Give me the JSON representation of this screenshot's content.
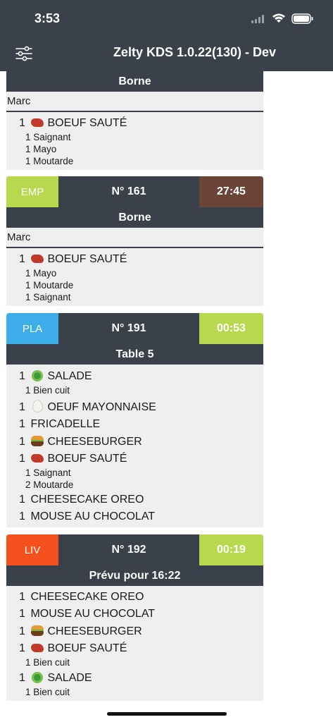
{
  "status": {
    "time": "3:53"
  },
  "nav": {
    "title": "Zelty KDS 1.0.22(130) - Dev"
  },
  "colors": {
    "EMP": "#b8d84e",
    "PLA": "#3daee9",
    "LIV": "#f4511e",
    "timer_late": "#6b4438",
    "timer_ok": "#b8d84e",
    "dark": "#3a414a"
  },
  "orders": [
    {
      "sub": "Borne",
      "customer": "Marc",
      "items": [
        {
          "qty": "1",
          "icon": "steak-icon",
          "name": "BOEUF SAUTÉ",
          "mods": [
            "1 Saignant",
            "1 Mayo",
            "1 Moutarde"
          ]
        }
      ]
    },
    {
      "type": "EMP",
      "number": "N° 161",
      "timer": "27:45",
      "sub": "Borne",
      "customer": "Marc",
      "items": [
        {
          "qty": "1",
          "icon": "steak-icon",
          "name": "BOEUF SAUTÉ",
          "mods": [
            "1 Mayo",
            "1 Moutarde",
            "1 Saignant"
          ]
        }
      ]
    },
    {
      "type": "PLA",
      "number": "N° 191",
      "timer": "00:53",
      "sub": "Table 5",
      "items": [
        {
          "qty": "1",
          "icon": "salad-icon",
          "name": "SALADE",
          "mods": [
            "1 Bien cuit"
          ]
        },
        {
          "qty": "1",
          "icon": "egg-icon",
          "name": "OEUF MAYONNAISE",
          "mods": []
        },
        {
          "qty": "1",
          "name": "FRICADELLE",
          "mods": []
        },
        {
          "qty": "1",
          "icon": "burger-icon",
          "name": "CHEESEBURGER",
          "mods": []
        },
        {
          "qty": "1",
          "icon": "steak-icon",
          "name": "BOEUF SAUTÉ",
          "mods": [
            "1 Saignant",
            "2 Moutarde"
          ]
        },
        {
          "qty": "1",
          "name": "CHEESECAKE OREO",
          "mods": []
        },
        {
          "qty": "1",
          "name": "MOUSE AU CHOCOLAT",
          "mods": []
        }
      ]
    },
    {
      "type": "LIV",
      "number": "N° 192",
      "timer": "00:19",
      "sub": "Prévu pour 16:22",
      "items": [
        {
          "qty": "1",
          "name": "CHEESECAKE OREO",
          "mods": []
        },
        {
          "qty": "1",
          "name": "MOUSE AU CHOCOLAT",
          "mods": []
        },
        {
          "qty": "1",
          "icon": "burger-icon",
          "name": "CHEESEBURGER",
          "mods": []
        },
        {
          "qty": "1",
          "icon": "steak-icon",
          "name": "BOEUF SAUTÉ",
          "mods": [
            "1 Bien cuit"
          ]
        },
        {
          "qty": "1",
          "icon": "salad-icon",
          "name": "SALADE",
          "mods": [
            "1 Bien cuit"
          ]
        }
      ]
    }
  ]
}
